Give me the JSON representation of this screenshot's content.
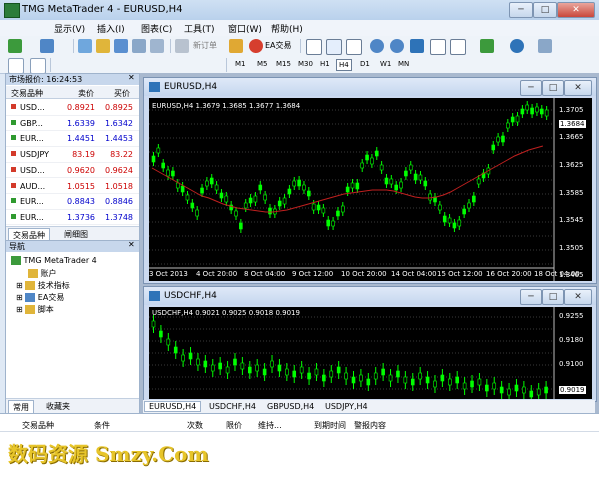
{
  "window": {
    "title": "TMG MetaTrader 4 - EURUSD,H4",
    "minimize": "─",
    "maximize": "□",
    "close": "✕"
  },
  "menu": [
    "显示(V)",
    "插入(I)",
    "图表(C)",
    "工具(T)",
    "窗口(W)",
    "帮助(H)"
  ],
  "toolbar": {
    "new_order": "新订单",
    "ea_trading": "EA交易"
  },
  "timeframes": [
    "M1",
    "M5",
    "M15",
    "M30",
    "H1",
    "H4",
    "D1",
    "W1",
    "MN"
  ],
  "market_watch": {
    "title": "市场报价: 16:24:53",
    "headers": {
      "symbol": "交易品种",
      "bid": "卖价",
      "ask": "买价"
    },
    "rows": [
      {
        "symbol": "USD...",
        "bid": "0.8921",
        "ask": "0.8925",
        "dir": "down"
      },
      {
        "symbol": "GBP...",
        "bid": "1.6339",
        "ask": "1.6342",
        "dir": "up"
      },
      {
        "symbol": "EUR...",
        "bid": "1.4451",
        "ask": "1.4453",
        "dir": "up"
      },
      {
        "symbol": "USDJPY",
        "bid": "83.19",
        "ask": "83.22",
        "dir": "down"
      },
      {
        "symbol": "USD...",
        "bid": "0.9620",
        "ask": "0.9624",
        "dir": "down"
      },
      {
        "symbol": "AUD...",
        "bid": "1.0515",
        "ask": "1.0518",
        "dir": "down"
      },
      {
        "symbol": "EUR...",
        "bid": "0.8843",
        "ask": "0.8846",
        "dir": "up"
      },
      {
        "symbol": "EUR...",
        "bid": "1.3736",
        "ask": "1.3748",
        "dir": "up"
      }
    ],
    "tabs": [
      "交易品种",
      "闸细图"
    ]
  },
  "navigator": {
    "title": "导航",
    "items": [
      "TMG MetaTrader 4",
      "账户",
      "技术指标",
      "EA交易",
      "脚本"
    ],
    "tabs": [
      "常用",
      "收藏夹"
    ]
  },
  "chart1": {
    "title": "EURUSD,H4",
    "ohlc": "EURUSD,H4  1.3679 1.3685 1.3677 1.3684",
    "price_labels": [
      "1.3705",
      "1.3684",
      "1.3665",
      "1.3625",
      "1.3585",
      "1.3545",
      "1.3505",
      "1.3465"
    ],
    "time_labels": [
      "3 Oct 2013",
      "4 Oct 20:00",
      "8 Oct 04:00",
      "9 Oct 12:00",
      "10 Oct 20:00",
      "14 Oct 04:00",
      "15 Oct 12:00",
      "16 Oct 20:00",
      "18 Oct 04:00"
    ]
  },
  "chart2": {
    "title": "USDCHF,H4",
    "ohlc": "USDCHF,H4  0.9021 0.9025 0.9018 0.9019",
    "price_labels": [
      "0.9255",
      "0.9180",
      "0.9100",
      "0.9019"
    ]
  },
  "chart_tabs": [
    "EURUSD,H4",
    "USDCHF,H4",
    "GBPUSD,H4",
    "USDJPY,H4"
  ],
  "terminal": {
    "headers": [
      "交易品种",
      "条件",
      "次数",
      "限价",
      "维持...",
      "到期时间",
      "警报内容"
    ]
  },
  "watermark": "数码资源 Smzy.Com",
  "colors": {
    "bull": "#00ff00",
    "ma": "#c0201f",
    "up_price": "#0000cc",
    "down_price": "#cc0000"
  }
}
